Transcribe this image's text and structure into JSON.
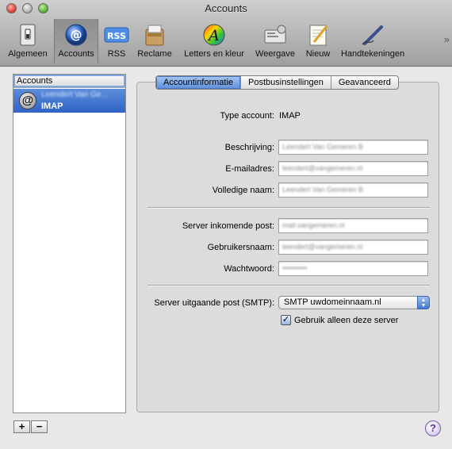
{
  "window": {
    "title": "Accounts"
  },
  "toolbar": {
    "items": [
      {
        "label": "Algemeen",
        "icon": "switch-icon"
      },
      {
        "label": "Accounts",
        "icon": "at-icon",
        "selected": true
      },
      {
        "label": "RSS",
        "icon": "rss-icon"
      },
      {
        "label": "Reclame",
        "icon": "junk-mail-icon"
      },
      {
        "label": "Letters en kleur",
        "icon": "fonts-colors-icon"
      },
      {
        "label": "Weergave",
        "icon": "viewing-icon"
      },
      {
        "label": "Nieuw",
        "icon": "compose-icon"
      },
      {
        "label": "Handtekeningen",
        "icon": "signature-pen-icon"
      }
    ],
    "overflow_glyph": "»",
    "rss_badge": "RSS"
  },
  "accounts": {
    "header": "Accounts",
    "items": [
      {
        "name": "Leendert Van Ge...",
        "type": "IMAP",
        "icon_glyph": "@"
      }
    ],
    "add_label": "+",
    "remove_label": "−"
  },
  "tabs": [
    "Accountinformatie",
    "Postbusinstellingen",
    "Geavanceerd"
  ],
  "form": {
    "type_label": "Type account:",
    "type_value": "IMAP",
    "description_label": "Beschrijving:",
    "description_value": "Leendert Van Gemeren B",
    "email_label": "E-mailadres:",
    "email_value": "leendert@vangemeren.nl",
    "fullname_label": "Volledige naam:",
    "fullname_value": "Leendert Van Gemeren B",
    "incoming_label": "Server inkomende post:",
    "incoming_value": "mail.vangemeren.nl",
    "username_label": "Gebruikersnaam:",
    "username_value": "leendert@vangemeren.nl",
    "password_label": "Wachtwoord:",
    "password_value": "••••••••••",
    "smtp_label": "Server uitgaande post (SMTP):",
    "smtp_value": "SMTP uwdomeinnaam.nl",
    "checkbox_label": "Gebruik alleen deze server",
    "checkbox_checked": true
  },
  "help": {
    "glyph": "?"
  },
  "colors": {
    "selection": "#3a6fd0",
    "tab_active": "#6d9de2"
  }
}
